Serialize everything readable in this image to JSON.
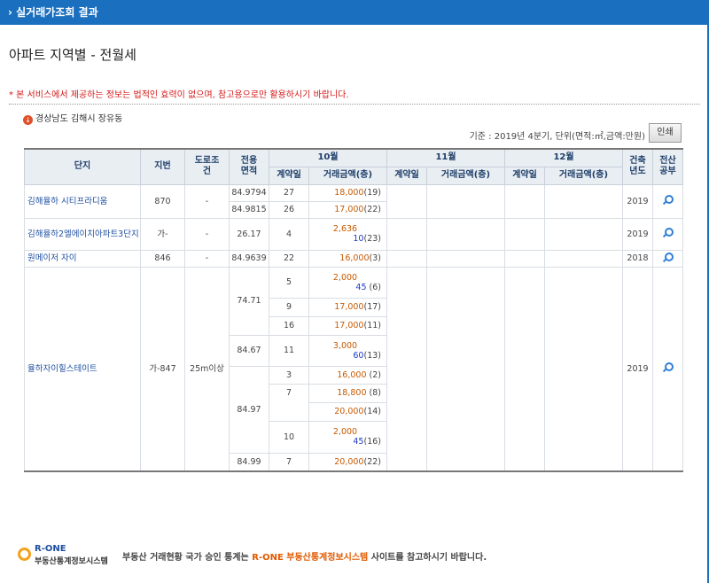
{
  "header": {
    "title": "› 실거래가조회 결과"
  },
  "page": {
    "title": "아파트 지역별 - 전월세"
  },
  "notice": "* 본 서비스에서 제공하는 정보는 법적인 효력이 없으며, 참고용으로만 활용하시기 바랍니다.",
  "region": {
    "icon": "download-icon",
    "text": "경상남도 김해시 장유동"
  },
  "basis": "기준 : 2019년 4분기, 단위(면적:㎡,금액:만원)",
  "print_label": "인쇄",
  "table": {
    "headers": {
      "complex": "단지",
      "lot": "지번",
      "road_1": "도로조",
      "road_2": "건",
      "area_1": "전용",
      "area_2": "면적",
      "oct": "10월",
      "nov": "11월",
      "dec": "12월",
      "contract_day": "계약일",
      "amount": "거래금액(층)",
      "built_1": "건축",
      "built_2": "년도",
      "record_1": "전산",
      "record_2": "공부"
    },
    "rows": {
      "r1": {
        "complex": "김해율하 시티프라디움",
        "lot": "870",
        "road": "-",
        "built": "2019",
        "area_a": "84.9794",
        "day_a": "27",
        "amt_a": "18,000",
        "floor_a": "(19)",
        "area_b": "84.9815",
        "day_b": "26",
        "amt_b": "17,000",
        "floor_b": "(22)"
      },
      "r2": {
        "complex": "김해율하2엘에이치아파트3단지",
        "lot": "가-",
        "road": "-",
        "area": "26.17",
        "day": "4",
        "deposit": "2,636",
        "rent": "10",
        "floor": "(23)",
        "built": "2019"
      },
      "r3": {
        "complex": "원메이저 자이",
        "lot": "846",
        "road": "-",
        "area": "84.9639",
        "day": "22",
        "amt": "16,000",
        "floor": "(3)",
        "built": "2018"
      },
      "r4": {
        "complex": "율하자이힐스테이트",
        "lot": "가-847",
        "road": "25m이상",
        "built": "2019",
        "area_1": "74.71",
        "area_2": "84.67",
        "area_3": "84.97",
        "area_4": "84.99",
        "d1": "5",
        "dep1": "2,000",
        "rent1": "45",
        "f1": "(6)",
        "d2": "9",
        "amt2": "17,000",
        "f2": "(17)",
        "d3": "16",
        "amt3": "17,000",
        "f3": "(11)",
        "d4": "11",
        "dep4": "3,000",
        "rent4": "60",
        "f4": "(13)",
        "d5": "3",
        "amt5": "16,000",
        "f5": "(2)",
        "d6": "7",
        "amt6": "18,800",
        "f6": "(8)",
        "amt7": "20,000",
        "f7": "(14)",
        "d8": "10",
        "dep8": "2,000",
        "rent8": "45",
        "f8": "(16)",
        "d9": "7",
        "amt9": "20,000",
        "f9": "(22)"
      }
    }
  },
  "footer": {
    "logo_name": "R-ONE",
    "logo_sub": "부동산통계정보시스템",
    "msg_a": "부동산 거래현황 국가 승인 통계는",
    "msg_b": "R-ONE 부동산통계정보시스템",
    "msg_c": "사이트를 참고하시기 바랍니다."
  },
  "colors": {
    "header_blue": "#1a6fbf",
    "notice_red": "#d41a1a",
    "deposit_orange": "#c75a00",
    "rent_blue": "#1a3cc8"
  }
}
